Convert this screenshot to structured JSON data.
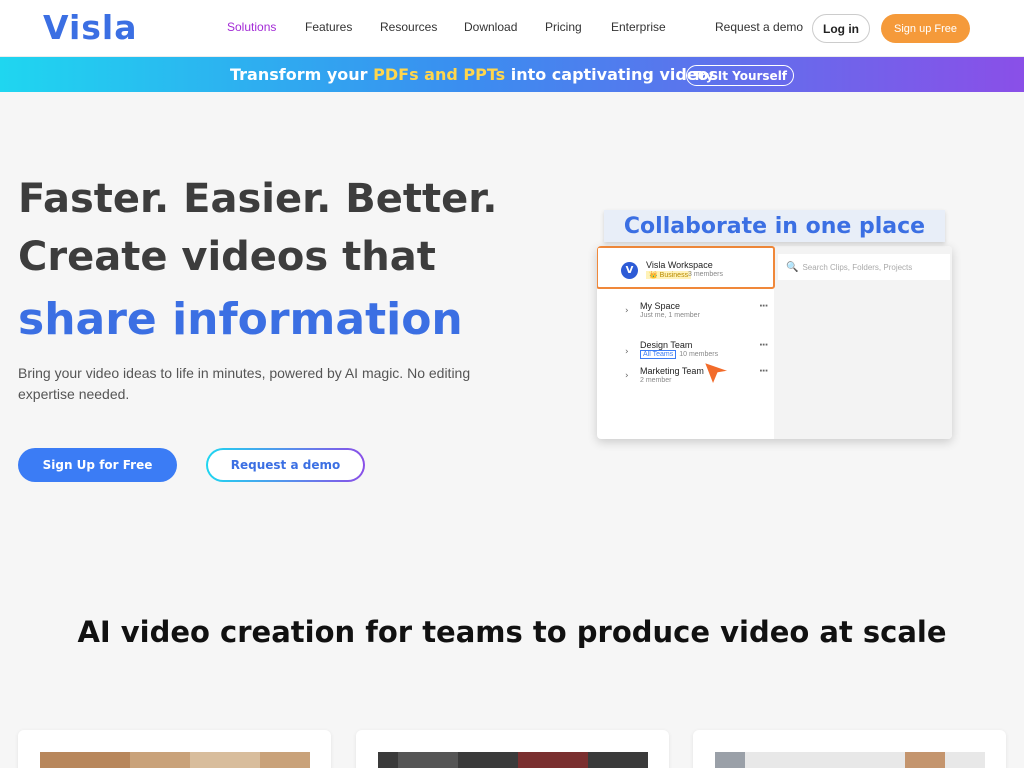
{
  "header": {
    "logo": "Visla",
    "nav": [
      {
        "label": "Solutions",
        "active": true
      },
      {
        "label": "Features",
        "active": false
      },
      {
        "label": "Resources",
        "active": false
      },
      {
        "label": "Download",
        "active": false
      },
      {
        "label": "Pricing",
        "active": false
      },
      {
        "label": "Enterprise",
        "active": false
      }
    ],
    "request_demo": "Request a demo",
    "login": "Log in",
    "signup": "Sign up Free"
  },
  "banner": {
    "text_before": "Transform your ",
    "highlight": "PDFs and PPTs",
    "text_after": " into captivating videos",
    "button": "Try It Yourself"
  },
  "hero": {
    "line1": "Faster. Easier. Better.",
    "line2": "Create videos that",
    "line3": "share information",
    "subtitle": "Bring your video ideas to life in minutes, powered by AI magic. No editing expertise needed.",
    "cta_primary": "Sign Up for Free",
    "cta_secondary": "Request a demo"
  },
  "mockup": {
    "title": "Collaborate in one place",
    "workspace_name": "Visla Workspace",
    "workspace_badge": "👑 Business",
    "workspace_members": "3 members",
    "search_placeholder": "Search Clips, Folders, Projects",
    "items": [
      {
        "name": "My Space",
        "meta": "Just me, 1 member",
        "tag": ""
      },
      {
        "name": "Design Team",
        "meta": "10 members",
        "tag": "All Teams"
      },
      {
        "name": "Marketing Team",
        "meta": "2 member",
        "tag": ""
      }
    ]
  },
  "section": {
    "title": "AI video creation for teams to produce video at scale"
  },
  "colors": {
    "brand_blue": "#3b6fe3",
    "accent_orange": "#f59a3a",
    "nav_active": "#a32bd6"
  }
}
